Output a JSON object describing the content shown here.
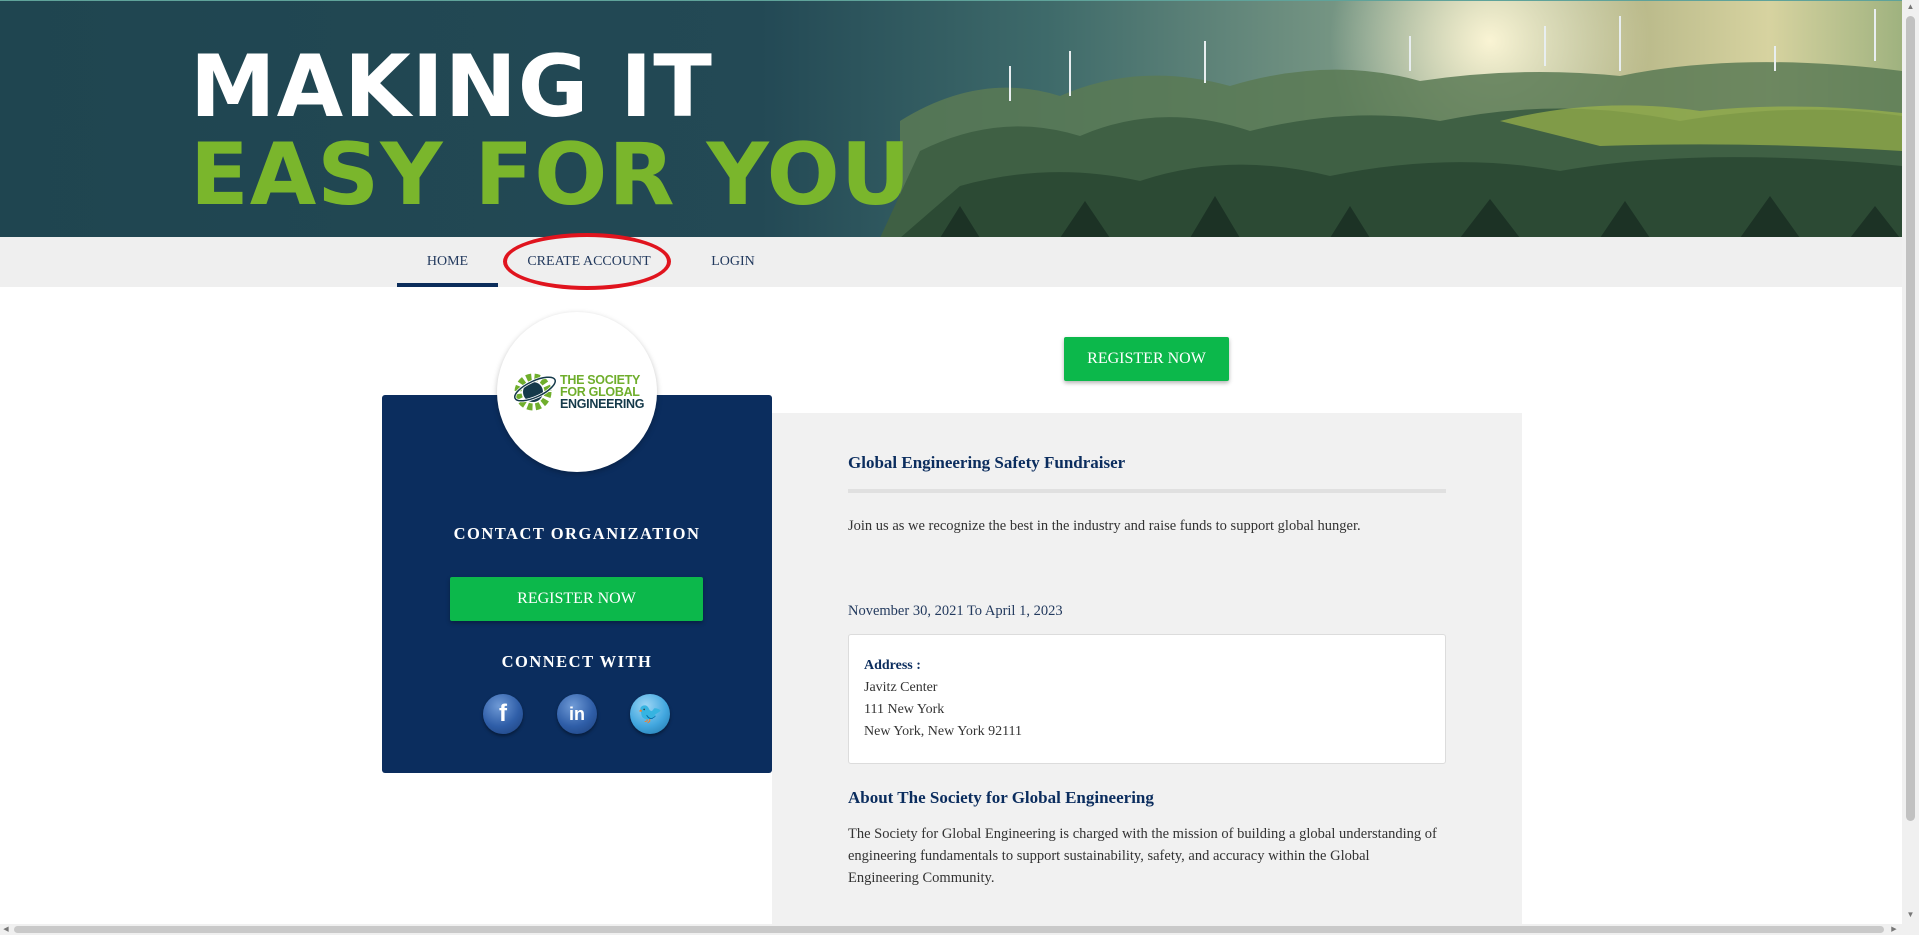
{
  "banner": {
    "line1": "MAKING IT",
    "line2": "EASY FOR YOU"
  },
  "nav": {
    "items": [
      {
        "label": "HOME",
        "active": true
      },
      {
        "label": "CREATE ACCOUNT",
        "active": false
      },
      {
        "label": "LOGIN",
        "active": false
      }
    ]
  },
  "org": {
    "logo_line1": "THE SOCIETY",
    "logo_line2": "FOR GLOBAL",
    "logo_line3": "ENGINEERING",
    "contact_title": "CONTACT ORGANIZATION",
    "register_label": "REGISTER NOW",
    "connect_title": "CONNECT WITH",
    "social": [
      {
        "name": "facebook-icon",
        "glyph": "f"
      },
      {
        "name": "linkedin-icon",
        "glyph": "in"
      },
      {
        "name": "twitter-icon",
        "glyph": "🐦"
      }
    ]
  },
  "event": {
    "register_label": "REGISTER NOW",
    "title": "Global Engineering Safety Fundraiser",
    "description": "Join us as we recognize the best in the industry and raise funds to support global hunger.",
    "dates": "November 30, 2021 To April 1, 2023",
    "address_label": "Address :",
    "address_lines": [
      "Javitz Center",
      "111 New York",
      "New York, New York 92111"
    ],
    "about_title": "About The Society for Global Engineering",
    "about_text": "The Society for Global Engineering is charged with the mission of building a global understanding of engineering fundamentals to support sustainability, safety, and accuracy within the Global Engineering Community."
  },
  "colors": {
    "navy": "#0b2d5e",
    "green_button": "#0cb84b",
    "headline_green": "#7ab62c",
    "annotation_red": "#e0141e"
  }
}
